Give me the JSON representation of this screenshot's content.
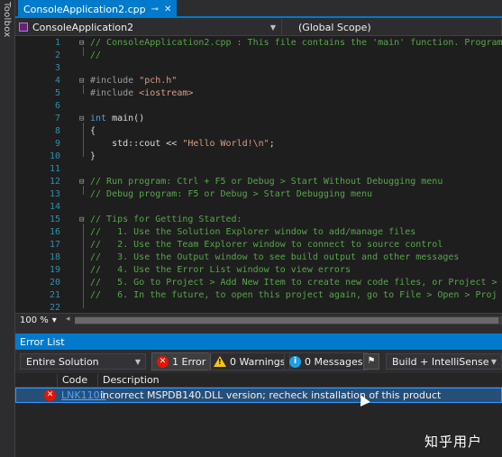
{
  "toolbox": {
    "label": "Toolbox"
  },
  "tab": {
    "title": "ConsoleApplication2.cpp",
    "pin_glyph": "⊸",
    "close_glyph": "✕"
  },
  "navbar": {
    "project": "ConsoleApplication2",
    "scope": "(Global Scope)"
  },
  "code_lines": [
    {
      "n": "1",
      "fold": "⊟",
      "segments": [
        {
          "cls": "c-comment",
          "t": "// ConsoleApplication2.cpp : This file contains the 'main' function. Program"
        }
      ]
    },
    {
      "n": "2",
      "fold": "",
      "segments": [
        {
          "cls": "c-comment",
          "t": "//"
        }
      ]
    },
    {
      "n": "3",
      "fold": "",
      "segments": []
    },
    {
      "n": "4",
      "fold": "⊟",
      "segments": [
        {
          "cls": "c-pp",
          "t": "#include "
        },
        {
          "cls": "c-str",
          "t": "\"pch.h\""
        }
      ]
    },
    {
      "n": "5",
      "fold": "",
      "segments": [
        {
          "cls": "c-pp",
          "t": "#include "
        },
        {
          "cls": "c-str",
          "t": "<iostream>"
        }
      ]
    },
    {
      "n": "6",
      "fold": "",
      "segments": []
    },
    {
      "n": "7",
      "fold": "⊟",
      "segments": [
        {
          "cls": "c-kw",
          "t": "int "
        },
        {
          "cls": "c-id",
          "t": "main()"
        }
      ]
    },
    {
      "n": "8",
      "fold": "",
      "segments": [
        {
          "cls": "c-plain",
          "t": "{"
        }
      ]
    },
    {
      "n": "9",
      "fold": "",
      "segments": [
        {
          "cls": "c-plain",
          "t": "    std::cout << "
        },
        {
          "cls": "c-str",
          "t": "\"Hello World!\\n\""
        },
        {
          "cls": "c-plain",
          "t": ";"
        }
      ]
    },
    {
      "n": "10",
      "fold": "",
      "segments": [
        {
          "cls": "c-plain",
          "t": "}"
        }
      ]
    },
    {
      "n": "11",
      "fold": "",
      "segments": []
    },
    {
      "n": "12",
      "fold": "⊟",
      "segments": [
        {
          "cls": "c-comment",
          "t": "// Run program: Ctrl + F5 or Debug > Start Without Debugging menu"
        }
      ]
    },
    {
      "n": "13",
      "fold": "",
      "segments": [
        {
          "cls": "c-comment",
          "t": "// Debug program: F5 or Debug > Start Debugging menu"
        }
      ]
    },
    {
      "n": "14",
      "fold": "",
      "segments": []
    },
    {
      "n": "15",
      "fold": "⊟",
      "segments": [
        {
          "cls": "c-comment",
          "t": "// Tips for Getting Started:"
        }
      ]
    },
    {
      "n": "16",
      "fold": "",
      "segments": [
        {
          "cls": "c-comment",
          "t": "//   1. Use the Solution Explorer window to add/manage files"
        }
      ]
    },
    {
      "n": "17",
      "fold": "",
      "segments": [
        {
          "cls": "c-comment",
          "t": "//   2. Use the Team Explorer window to connect to source control"
        }
      ]
    },
    {
      "n": "18",
      "fold": "",
      "segments": [
        {
          "cls": "c-comment",
          "t": "//   3. Use the Output window to see build output and other messages"
        }
      ]
    },
    {
      "n": "19",
      "fold": "",
      "segments": [
        {
          "cls": "c-comment",
          "t": "//   4. Use the Error List window to view errors"
        }
      ]
    },
    {
      "n": "20",
      "fold": "",
      "segments": [
        {
          "cls": "c-comment",
          "t": "//   5. Go to Project > Add New Item to create new code files, or Project >"
        }
      ]
    },
    {
      "n": "21",
      "fold": "",
      "segments": [
        {
          "cls": "c-comment",
          "t": "//   6. In the future, to open this project again, go to File > Open > Proj"
        }
      ]
    },
    {
      "n": "22",
      "fold": "",
      "segments": []
    }
  ],
  "editor_status": {
    "zoom": "100 %",
    "zoom_arrow": "▾",
    "scroll_left": "◂"
  },
  "error_list": {
    "title": "Error List",
    "scope": "Entire Solution",
    "errors_btn": "1 Error",
    "warnings_btn": "0 Warnings",
    "messages_btn": "0 Messages",
    "build_filter": "Build + IntelliSense",
    "columns": {
      "code": "Code",
      "description": "Description"
    },
    "rows": [
      {
        "code": "LNK1101",
        "description": "incorrect MSPDB140.DLL version; recheck installation of this product"
      }
    ]
  },
  "watermark": "知乎用户",
  "colors": {
    "accent": "#007acc",
    "error": "#e51400",
    "warning": "#f5c518",
    "info": "#1ba1e2",
    "comment": "#57a64a",
    "keyword": "#569cd6",
    "string": "#d69d85"
  }
}
